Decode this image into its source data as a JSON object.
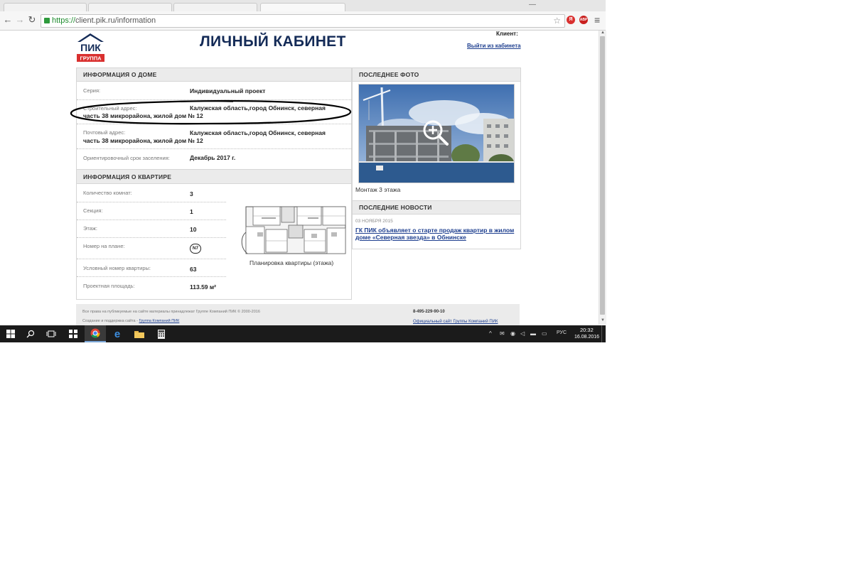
{
  "browser": {
    "url_scheme": "https://",
    "url_rest": "client.pik.ru/information",
    "ext_yandex": "Я",
    "ext_adblock": "ABP",
    "menu_glyph": "≡"
  },
  "header": {
    "logo_text": "ПИК",
    "logo_sub": "ГРУППА",
    "title": "ЛИЧНЫЙ КАБИНЕТ",
    "client_label": "Клиент:",
    "logout": "Выйти из кабинета"
  },
  "house": {
    "heading": "ИНФОРМАЦИЯ О ДОМЕ",
    "series_label": "Серия:",
    "series_value": "Индивидуальный проект",
    "build_address_label": "Строительный адрес:",
    "build_address_value_line1": "Калужская область,город Обнинск, северная",
    "build_address_value_line2": "часть 38 микрорайона, жилой дом № 12",
    "postal_address_label": "Почтовый адрес:",
    "postal_address_value_line1": "Калужская область,город Обнинск, северная",
    "postal_address_value_line2": "часть 38 микрорайона, жилой дом № 12",
    "settlement_label": "Ориентировочный срок заселения:",
    "settlement_value": "Декабрь 2017 г."
  },
  "apartment": {
    "heading": "ИНФОРМАЦИЯ О КВАРТИРЕ",
    "rows": [
      {
        "label": "Количество комнат:",
        "value": "3"
      },
      {
        "label": "Секция:",
        "value": "1"
      },
      {
        "label": "Этаж:",
        "value": "10"
      },
      {
        "label": "Номер на плане:",
        "value": "N7"
      },
      {
        "label": "Условный номер квартиры:",
        "value": "63"
      },
      {
        "label": "Проектная площадь:",
        "value": "113.59 м²"
      }
    ],
    "plan_caption": "Планировка квартиры (этажа)"
  },
  "photo": {
    "heading": "ПОСЛЕДНЕЕ ФОТО",
    "caption": "Монтаж 3 этажа"
  },
  "news": {
    "heading": "ПОСЛЕДНИЕ НОВОСТИ",
    "date": "03 НОЯБРЯ 2015",
    "title": "ГК ПИК объявляет о старте продаж квартир в жилом доме «Северная звезда» в Обнинске"
  },
  "footer": {
    "copyright": "Все права на публикуемые на сайте материалы принадлежат Группе Компаний ПИК © 2000-2016",
    "support_prefix": "Создание и поддержка сайта - ",
    "support_link": "Группа Компаний ПИК",
    "phone": "8-495-229-90-10",
    "official_site": "Официальный сайт Группы Компаний ПИК"
  },
  "taskbar": {
    "lang": "РУС",
    "time": "20:32",
    "date": "16.08.2016"
  },
  "colors": {
    "brand_blue": "#142b57",
    "brand_red": "#d9302f",
    "link": "#1e3f8f",
    "panel_header": "#ebebeb"
  }
}
